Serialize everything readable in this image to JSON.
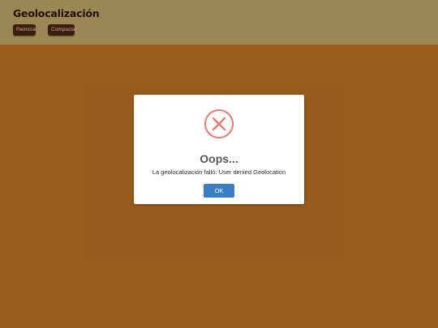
{
  "header": {
    "title": "Geolocalización",
    "buttons": {
      "reiniciar": "Reiniciar",
      "compactar": "Compactar"
    }
  },
  "dialog": {
    "icon": "error-x-icon",
    "title": "Oops...",
    "message": "La geolocalización falló: User denied Geolocation",
    "ok_label": "OK"
  },
  "colors": {
    "header_bg": "#9a8753",
    "page_bg": "#9a5c1b",
    "button_bg": "#3b1e10",
    "error_red": "#f27474",
    "ok_blue": "#3b7ec6"
  }
}
